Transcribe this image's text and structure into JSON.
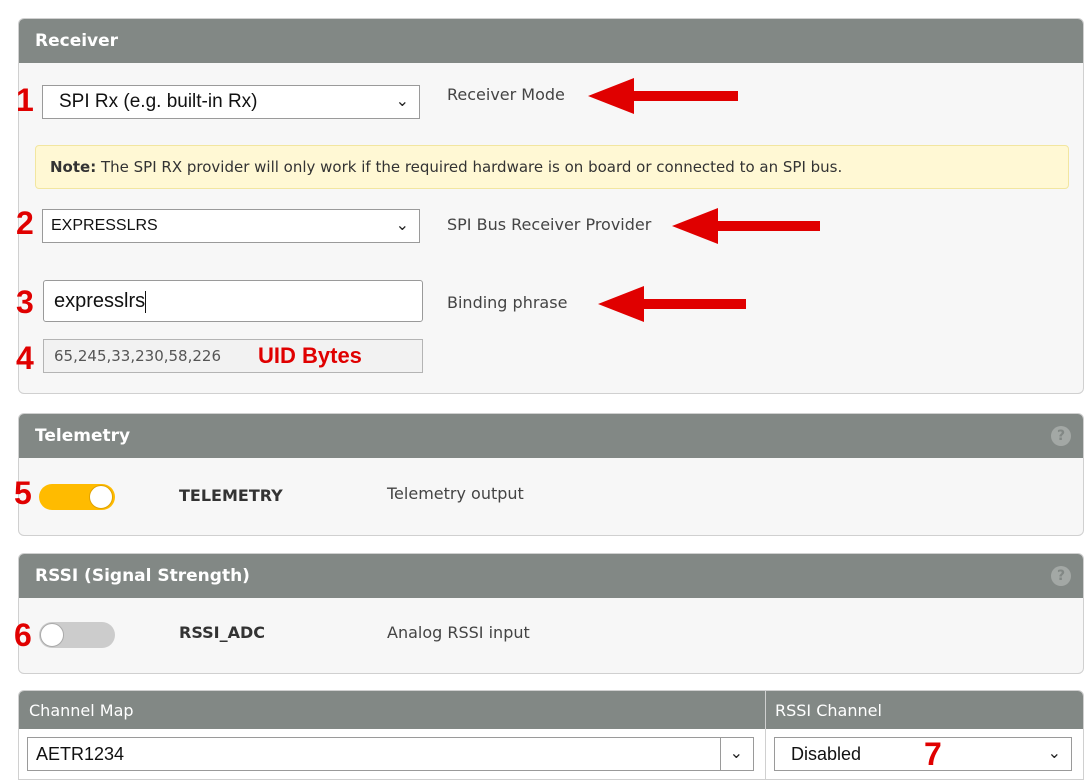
{
  "receiver": {
    "header": "Receiver",
    "mode_select_value": "SPI Rx (e.g. built-in Rx)",
    "mode_label": "Receiver Mode",
    "note_bold": "Note:",
    "note_text": " The SPI RX provider will only work if the required hardware is on board or connected to an SPI bus.",
    "provider_select_value": "EXPRESSLRS",
    "provider_label": "SPI Bus Receiver Provider",
    "binding_value": "expresslrs",
    "binding_label": "Binding phrase",
    "uid_value": "65,245,33,230,58,226"
  },
  "telemetry": {
    "header": "Telemetry",
    "help": "?",
    "switch_name": "TELEMETRY",
    "switch_desc": "Telemetry output",
    "enabled": true
  },
  "rssi": {
    "header": "RSSI (Signal Strength)",
    "help": "?",
    "switch_name": "RSSI_ADC",
    "switch_desc": "Analog RSSI input",
    "enabled": false
  },
  "channel_map": {
    "header": "Channel Map",
    "value": "AETR1234"
  },
  "rssi_channel": {
    "header": "RSSI Channel",
    "value": "Disabled"
  },
  "annotations": {
    "n1": "1",
    "n2": "2",
    "n3": "3",
    "n4": "4",
    "n5": "5",
    "n6": "6",
    "n7": "7",
    "uid_bytes_label": "UID Bytes",
    "color": "#e00000"
  },
  "colors": {
    "header_bg": "#828885",
    "toggle_on": "#ffbb00",
    "toggle_off": "#cccccc",
    "note_bg": "#fff8d4"
  },
  "icons": {
    "dropdown": "chevron-down-icon",
    "help": "help-icon",
    "annotation": "red-arrow-icon"
  }
}
